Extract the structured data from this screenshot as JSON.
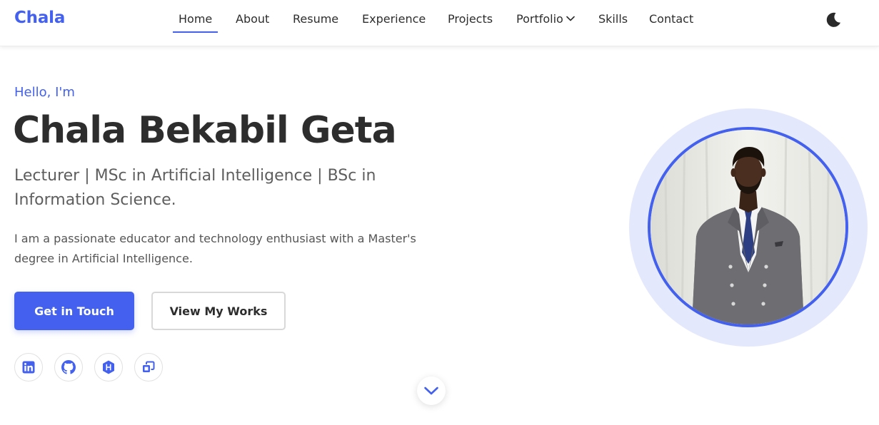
{
  "brand": {
    "logo": "Chala",
    "accent": "#4361ee"
  },
  "nav": {
    "items": [
      {
        "label": "Home",
        "active": true
      },
      {
        "label": "About"
      },
      {
        "label": "Resume"
      },
      {
        "label": "Experience"
      },
      {
        "label": "Projects"
      },
      {
        "label": "Portfolio",
        "dropdown": true
      },
      {
        "label": "Skills"
      },
      {
        "label": "Contact"
      }
    ],
    "theme_toggle_icon": "moon-icon"
  },
  "hero": {
    "greeting": "Hello, I'm",
    "name": "Chala Bekabil Geta",
    "subtitle": "Lecturer | MSc in Artificial Intelligence | BSc in Information Science.",
    "description": "I am a passionate educator and technology enthusiast with a Master's degree in Artificial Intelligence.",
    "primary_button": "Get in Touch",
    "secondary_button": "View My Works",
    "socials": [
      {
        "icon": "linkedin-icon"
      },
      {
        "icon": "github-icon"
      },
      {
        "icon": "hackerrank-icon"
      },
      {
        "icon": "code-platform-icon"
      }
    ],
    "scroll_icon": "chevron-down-icon",
    "profile_photo": "portrait-photo"
  }
}
